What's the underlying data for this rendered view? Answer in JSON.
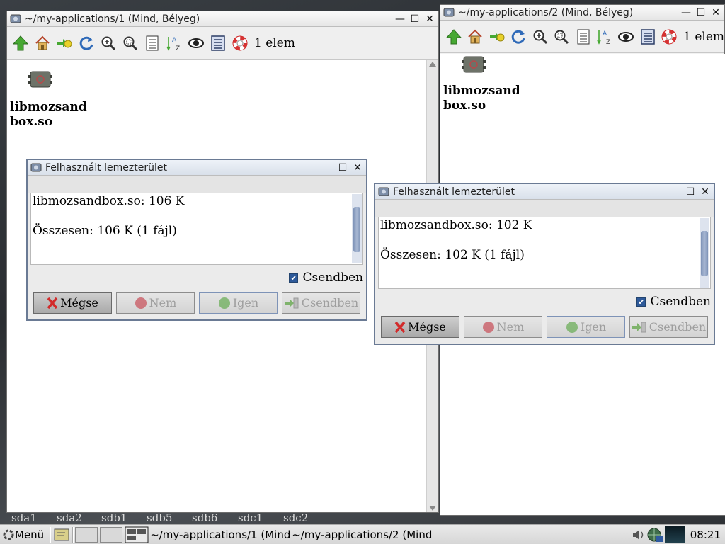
{
  "desktop": {
    "labels": [
      "sda1",
      "sda2",
      "sdb1",
      "sdb5",
      "sdb6",
      "sdc1",
      "sdc2"
    ]
  },
  "window1": {
    "title": "~/my-applications/1 (Mind, Bélyeg)",
    "count": "1 elem",
    "file_name": "libmozsandbox.so",
    "icon_names": [
      "up-arrow-icon",
      "home-icon",
      "bookmark-icon",
      "refresh-icon",
      "zoom-in-icon",
      "zoom-fit-icon",
      "details-view-icon",
      "sort-az-icon",
      "show-hidden-icon",
      "list-view-icon",
      "help-lifebuoy-icon"
    ]
  },
  "window2": {
    "title": "~/my-applications/2 (Mind, Bélyeg)",
    "count": "1 elem",
    "file_name": "libmozsandbox.so"
  },
  "dialog1": {
    "title": "Felhasznált lemezterület",
    "line1": "libmozsandbox.so: 106 K",
    "line2": "Összesen: 106 K (1 fájl)",
    "quiet_label": "Csendben",
    "quiet_checked": true,
    "buttons": {
      "cancel": "Mégse",
      "no": "Nem",
      "yes": "Igen",
      "quiet": "Csendben"
    }
  },
  "dialog2": {
    "title": "Felhasznált lemezterület",
    "line1": "libmozsandbox.so: 102 K",
    "line2": "Összesen: 102 K (1 fájl)",
    "quiet_label": "Csendben",
    "quiet_checked": true,
    "buttons": {
      "cancel": "Mégse",
      "no": "Nem",
      "yes": "Igen",
      "quiet": "Csendben"
    }
  },
  "taskbar": {
    "menu_label": "Menü",
    "tasks": [
      "~/my-applications/1 (Mind",
      "~/my-applications/2 (Mind"
    ],
    "clock": "08:21"
  },
  "colors": {
    "accent": "#2e5a9a",
    "dialog_border": "#6a7a94",
    "scroll_thumb": "#7e93b7",
    "cancel_icon": "#d22b2b",
    "icon_green": "#46a832"
  }
}
